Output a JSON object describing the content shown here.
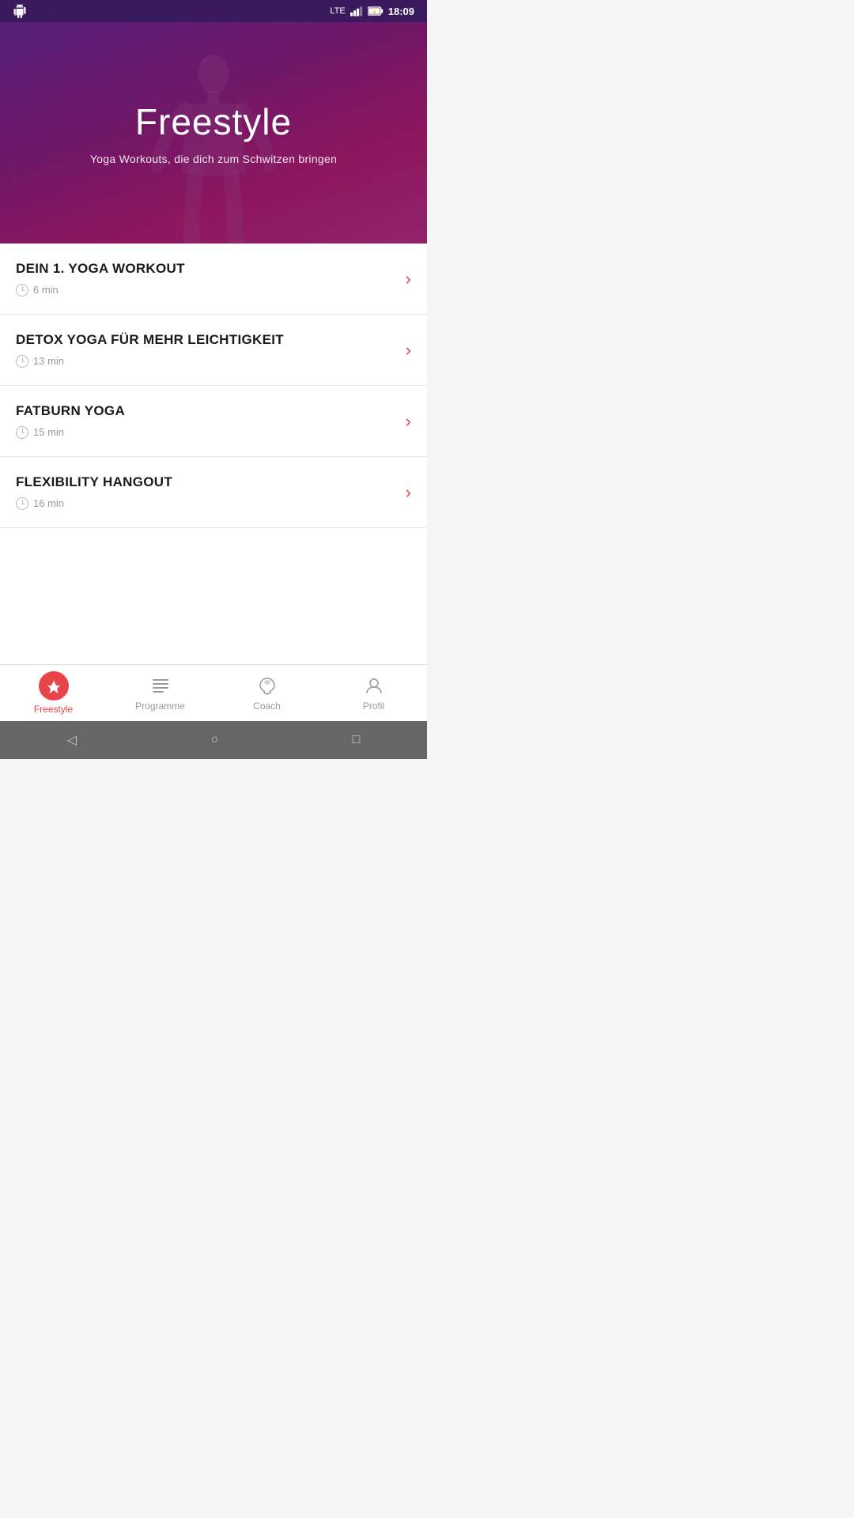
{
  "statusBar": {
    "time": "18:09",
    "signal": "LTE",
    "battery": "⚡"
  },
  "hero": {
    "title": "Freestyle",
    "subtitle": "Yoga Workouts, die dich zum Schwitzen bringen"
  },
  "workouts": [
    {
      "id": 1,
      "name": "DEIN 1. YOGA WORKOUT",
      "duration": "6 min"
    },
    {
      "id": 2,
      "name": "DETOX YOGA FÜR MEHR LEICHTIGKEIT",
      "duration": "13 min"
    },
    {
      "id": 3,
      "name": "FATBURN YOGA",
      "duration": "15 min"
    },
    {
      "id": 4,
      "name": "FLEXIBILITY HANGOUT",
      "duration": "16 min"
    }
  ],
  "bottomNav": {
    "items": [
      {
        "id": "freestyle",
        "label": "Freestyle",
        "active": true
      },
      {
        "id": "programme",
        "label": "Programme",
        "active": false
      },
      {
        "id": "coach",
        "label": "Coach",
        "active": false
      },
      {
        "id": "profil",
        "label": "Profil",
        "active": false
      }
    ]
  },
  "androidNav": {
    "back": "◁",
    "home": "○",
    "recent": "□"
  }
}
